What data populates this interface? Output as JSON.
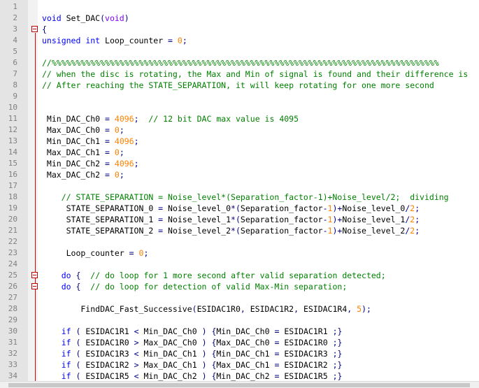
{
  "editor": {
    "lines": [
      {
        "n": "1",
        "fold": false,
        "tokens": []
      },
      {
        "n": "2",
        "fold": false,
        "tokens": [
          [
            "kw",
            "void"
          ],
          [
            "id",
            " Set_DAC"
          ],
          [
            "op",
            "("
          ],
          [
            "kw2",
            "void"
          ],
          [
            "op",
            ")"
          ]
        ]
      },
      {
        "n": "3",
        "fold": true,
        "tokens": [
          [
            "op",
            "{"
          ]
        ]
      },
      {
        "n": "4",
        "fold": false,
        "tokens": [
          [
            "kw",
            "unsigned"
          ],
          [
            "id",
            " "
          ],
          [
            "kw",
            "int"
          ],
          [
            "id",
            " Loop_counter "
          ],
          [
            "op",
            "="
          ],
          [
            "id",
            " "
          ],
          [
            "num",
            "0"
          ],
          [
            "op",
            ";"
          ]
        ]
      },
      {
        "n": "5",
        "fold": false,
        "tokens": []
      },
      {
        "n": "6",
        "fold": false,
        "tokens": [
          [
            "cm",
            "//%%%%%%%%%%%%%%%%%%%%%%%%%%%%%%%%%%%%%%%%%%%%%%%%%%%%%%%%%%%%%%%%%%%%%%%%%%%%%%%%"
          ]
        ]
      },
      {
        "n": "7",
        "fold": false,
        "tokens": [
          [
            "cm",
            "// when the disc is rotating, the Max and Min of signal is found and their difference is"
          ]
        ]
      },
      {
        "n": "8",
        "fold": false,
        "tokens": [
          [
            "cm",
            "// After reaching the STATE_SEPARATION, it will keep rotating for one more second"
          ]
        ]
      },
      {
        "n": "9",
        "fold": false,
        "tokens": []
      },
      {
        "n": "10",
        "fold": false,
        "tokens": []
      },
      {
        "n": "11",
        "fold": false,
        "tokens": [
          [
            "id",
            " Min_DAC_Ch0 "
          ],
          [
            "op",
            "="
          ],
          [
            "id",
            " "
          ],
          [
            "num",
            "4096"
          ],
          [
            "op",
            ";"
          ],
          [
            "id",
            "  "
          ],
          [
            "cm",
            "// 12 bit DAC max value is 4095"
          ]
        ]
      },
      {
        "n": "12",
        "fold": false,
        "tokens": [
          [
            "id",
            " Max_DAC_Ch0 "
          ],
          [
            "op",
            "="
          ],
          [
            "id",
            " "
          ],
          [
            "num",
            "0"
          ],
          [
            "op",
            ";"
          ]
        ]
      },
      {
        "n": "13",
        "fold": false,
        "tokens": [
          [
            "id",
            " Min_DAC_Ch1 "
          ],
          [
            "op",
            "="
          ],
          [
            "id",
            " "
          ],
          [
            "num",
            "4096"
          ],
          [
            "op",
            ";"
          ]
        ]
      },
      {
        "n": "14",
        "fold": false,
        "tokens": [
          [
            "id",
            " Max_DAC_Ch1 "
          ],
          [
            "op",
            "="
          ],
          [
            "id",
            " "
          ],
          [
            "num",
            "0"
          ],
          [
            "op",
            ";"
          ]
        ]
      },
      {
        "n": "15",
        "fold": false,
        "tokens": [
          [
            "id",
            " Min_DAC_Ch2 "
          ],
          [
            "op",
            "="
          ],
          [
            "id",
            " "
          ],
          [
            "num",
            "4096"
          ],
          [
            "op",
            ";"
          ]
        ]
      },
      {
        "n": "16",
        "fold": false,
        "tokens": [
          [
            "id",
            " Max_DAC_Ch2 "
          ],
          [
            "op",
            "="
          ],
          [
            "id",
            " "
          ],
          [
            "num",
            "0"
          ],
          [
            "op",
            ";"
          ]
        ]
      },
      {
        "n": "17",
        "fold": false,
        "tokens": []
      },
      {
        "n": "18",
        "fold": false,
        "tokens": [
          [
            "id",
            "    "
          ],
          [
            "cm",
            "// STATE_SEPARATION = Noise_level*(Separation_factor-1)+Noise_level/2;  dividing"
          ]
        ]
      },
      {
        "n": "19",
        "fold": false,
        "tokens": [
          [
            "id",
            "     STATE_SEPARATION_0 "
          ],
          [
            "op",
            "="
          ],
          [
            "id",
            " Noise_level_0"
          ],
          [
            "op",
            "*("
          ],
          [
            "id",
            "Separation_factor"
          ],
          [
            "op",
            "-"
          ],
          [
            "num",
            "1"
          ],
          [
            "op",
            ")+"
          ],
          [
            "id",
            "Noise_level_0"
          ],
          [
            "op",
            "/"
          ],
          [
            "num",
            "2"
          ],
          [
            "op",
            ";"
          ]
        ]
      },
      {
        "n": "20",
        "fold": false,
        "tokens": [
          [
            "id",
            "     STATE_SEPARATION_1 "
          ],
          [
            "op",
            "="
          ],
          [
            "id",
            " Noise_level_1"
          ],
          [
            "op",
            "*("
          ],
          [
            "id",
            "Separation_factor"
          ],
          [
            "op",
            "-"
          ],
          [
            "num",
            "1"
          ],
          [
            "op",
            ")+"
          ],
          [
            "id",
            "Noise_level_1"
          ],
          [
            "op",
            "/"
          ],
          [
            "num",
            "2"
          ],
          [
            "op",
            ";"
          ]
        ]
      },
      {
        "n": "21",
        "fold": false,
        "tokens": [
          [
            "id",
            "     STATE_SEPARATION_2 "
          ],
          [
            "op",
            "="
          ],
          [
            "id",
            " Noise_level_2"
          ],
          [
            "op",
            "*("
          ],
          [
            "id",
            "Separation_factor"
          ],
          [
            "op",
            "-"
          ],
          [
            "num",
            "1"
          ],
          [
            "op",
            ")+"
          ],
          [
            "id",
            "Noise_level_2"
          ],
          [
            "op",
            "/"
          ],
          [
            "num",
            "2"
          ],
          [
            "op",
            ";"
          ]
        ]
      },
      {
        "n": "22",
        "fold": false,
        "tokens": []
      },
      {
        "n": "23",
        "fold": false,
        "tokens": [
          [
            "id",
            "     Loop_counter "
          ],
          [
            "op",
            "="
          ],
          [
            "id",
            " "
          ],
          [
            "num",
            "0"
          ],
          [
            "op",
            ";"
          ]
        ]
      },
      {
        "n": "24",
        "fold": false,
        "tokens": []
      },
      {
        "n": "25",
        "fold": true,
        "tokens": [
          [
            "id",
            "    "
          ],
          [
            "kw",
            "do"
          ],
          [
            "id",
            " "
          ],
          [
            "op",
            "{"
          ],
          [
            "id",
            "  "
          ],
          [
            "cm",
            "// do loop for 1 more second after valid separation detected;"
          ]
        ]
      },
      {
        "n": "26",
        "fold": true,
        "tokens": [
          [
            "id",
            "    "
          ],
          [
            "kw",
            "do"
          ],
          [
            "id",
            " "
          ],
          [
            "op",
            "{"
          ],
          [
            "id",
            "  "
          ],
          [
            "cm",
            "// do loop for detection of valid Max-Min separation;"
          ]
        ]
      },
      {
        "n": "27",
        "fold": false,
        "tokens": []
      },
      {
        "n": "28",
        "fold": false,
        "tokens": [
          [
            "id",
            "        FindDAC_Fast_Successive"
          ],
          [
            "op",
            "("
          ],
          [
            "id",
            "ESIDAC1R0"
          ],
          [
            "op",
            ","
          ],
          [
            "id",
            " ESIDAC1R2"
          ],
          [
            "op",
            ","
          ],
          [
            "id",
            " ESIDAC1R4"
          ],
          [
            "op",
            ","
          ],
          [
            "id",
            " "
          ],
          [
            "num",
            "5"
          ],
          [
            "op",
            ");"
          ]
        ]
      },
      {
        "n": "29",
        "fold": false,
        "tokens": []
      },
      {
        "n": "30",
        "fold": false,
        "tokens": [
          [
            "id",
            "    "
          ],
          [
            "kw",
            "if"
          ],
          [
            "id",
            " "
          ],
          [
            "op",
            "("
          ],
          [
            "id",
            " ESIDAC1R1 "
          ],
          [
            "op",
            "<"
          ],
          [
            "id",
            " Min_DAC_Ch0 "
          ],
          [
            "op",
            ")"
          ],
          [
            "id",
            " "
          ],
          [
            "op",
            "{"
          ],
          [
            "id",
            "Min_DAC_Ch0 "
          ],
          [
            "op",
            "="
          ],
          [
            "id",
            " ESIDAC1R1 "
          ],
          [
            "op",
            ";}"
          ]
        ]
      },
      {
        "n": "31",
        "fold": false,
        "tokens": [
          [
            "id",
            "    "
          ],
          [
            "kw",
            "if"
          ],
          [
            "id",
            " "
          ],
          [
            "op",
            "("
          ],
          [
            "id",
            " ESIDAC1R0 "
          ],
          [
            "op",
            ">"
          ],
          [
            "id",
            " Max_DAC_Ch0 "
          ],
          [
            "op",
            ")"
          ],
          [
            "id",
            " "
          ],
          [
            "op",
            "{"
          ],
          [
            "id",
            "Max_DAC_Ch0 "
          ],
          [
            "op",
            "="
          ],
          [
            "id",
            " ESIDAC1R0 "
          ],
          [
            "op",
            ";}"
          ]
        ]
      },
      {
        "n": "32",
        "fold": false,
        "tokens": [
          [
            "id",
            "    "
          ],
          [
            "kw",
            "if"
          ],
          [
            "id",
            " "
          ],
          [
            "op",
            "("
          ],
          [
            "id",
            " ESIDAC1R3 "
          ],
          [
            "op",
            "<"
          ],
          [
            "id",
            " Min_DAC_Ch1 "
          ],
          [
            "op",
            ")"
          ],
          [
            "id",
            " "
          ],
          [
            "op",
            "{"
          ],
          [
            "id",
            "Min_DAC_Ch1 "
          ],
          [
            "op",
            "="
          ],
          [
            "id",
            " ESIDAC1R3 "
          ],
          [
            "op",
            ";}"
          ]
        ]
      },
      {
        "n": "33",
        "fold": false,
        "tokens": [
          [
            "id",
            "    "
          ],
          [
            "kw",
            "if"
          ],
          [
            "id",
            " "
          ],
          [
            "op",
            "("
          ],
          [
            "id",
            " ESIDAC1R2 "
          ],
          [
            "op",
            ">"
          ],
          [
            "id",
            " Max_DAC_Ch1 "
          ],
          [
            "op",
            ")"
          ],
          [
            "id",
            " "
          ],
          [
            "op",
            "{"
          ],
          [
            "id",
            "Max_DAC_Ch1 "
          ],
          [
            "op",
            "="
          ],
          [
            "id",
            " ESIDAC1R2 "
          ],
          [
            "op",
            ";}"
          ]
        ]
      },
      {
        "n": "34",
        "fold": false,
        "tokens": [
          [
            "id",
            "    "
          ],
          [
            "kw",
            "if"
          ],
          [
            "id",
            " "
          ],
          [
            "op",
            "("
          ],
          [
            "id",
            " ESIDAC1R5 "
          ],
          [
            "op",
            "<"
          ],
          [
            "id",
            " Min_DAC_Ch2 "
          ],
          [
            "op",
            ")"
          ],
          [
            "id",
            " "
          ],
          [
            "op",
            "{"
          ],
          [
            "id",
            "Min_DAC_Ch2 "
          ],
          [
            "op",
            "="
          ],
          [
            "id",
            " ESIDAC1R5 "
          ],
          [
            "op",
            ";}"
          ]
        ]
      }
    ]
  },
  "colors": {
    "keyword": "#0000ff",
    "type_keyword": "#8000ff",
    "number": "#ff8000",
    "comment": "#008000",
    "operator": "#000080",
    "fold_marker": "#c00000",
    "line_number": "#808080"
  }
}
